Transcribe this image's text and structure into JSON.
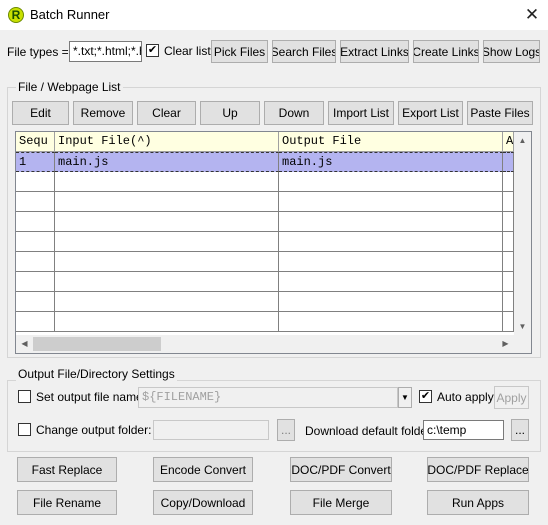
{
  "window": {
    "title": "Batch Runner",
    "icon_letter": "R"
  },
  "toolbar": {
    "file_types_label": "File types =>",
    "file_types_value": "*.txt;*.html;*.ht",
    "clear_list_label": "Clear list",
    "clear_list_checked": "✔",
    "pick_files": "Pick Files",
    "search_files": "Search Files",
    "extract_links": "Extract Links",
    "create_links": "Create Links",
    "show_logs": "Show Logs"
  },
  "file_list": {
    "group_title": "File / Webpage List",
    "buttons": [
      "Edit",
      "Remove",
      "Clear",
      "Up",
      "Down",
      "Import List",
      "Export List",
      "Paste Files"
    ],
    "columns": [
      "Sequ",
      "Input File(^)",
      "Output File",
      "A"
    ],
    "rows": [
      {
        "seq": "1",
        "input": "main.js",
        "output": "main.js"
      }
    ]
  },
  "output": {
    "group_title": "Output File/Directory Settings",
    "set_output_label": "Set output file name:",
    "output_name_value": "${FILENAME}",
    "auto_apply_label": "Auto apply",
    "auto_apply_checked": "✔",
    "apply_label": "Apply",
    "change_folder_label": "Change output folder:",
    "browse1": "...",
    "download_folder_label": "Download default folder:",
    "download_folder_value": "c:\\temp",
    "browse2": "..."
  },
  "actions": {
    "row1": [
      "Fast Replace",
      "Encode Convert",
      "DOC/PDF Convert",
      "DOC/PDF Replace"
    ],
    "row2": [
      "File Rename",
      "Copy/Download",
      "File Merge",
      "Run Apps"
    ]
  }
}
